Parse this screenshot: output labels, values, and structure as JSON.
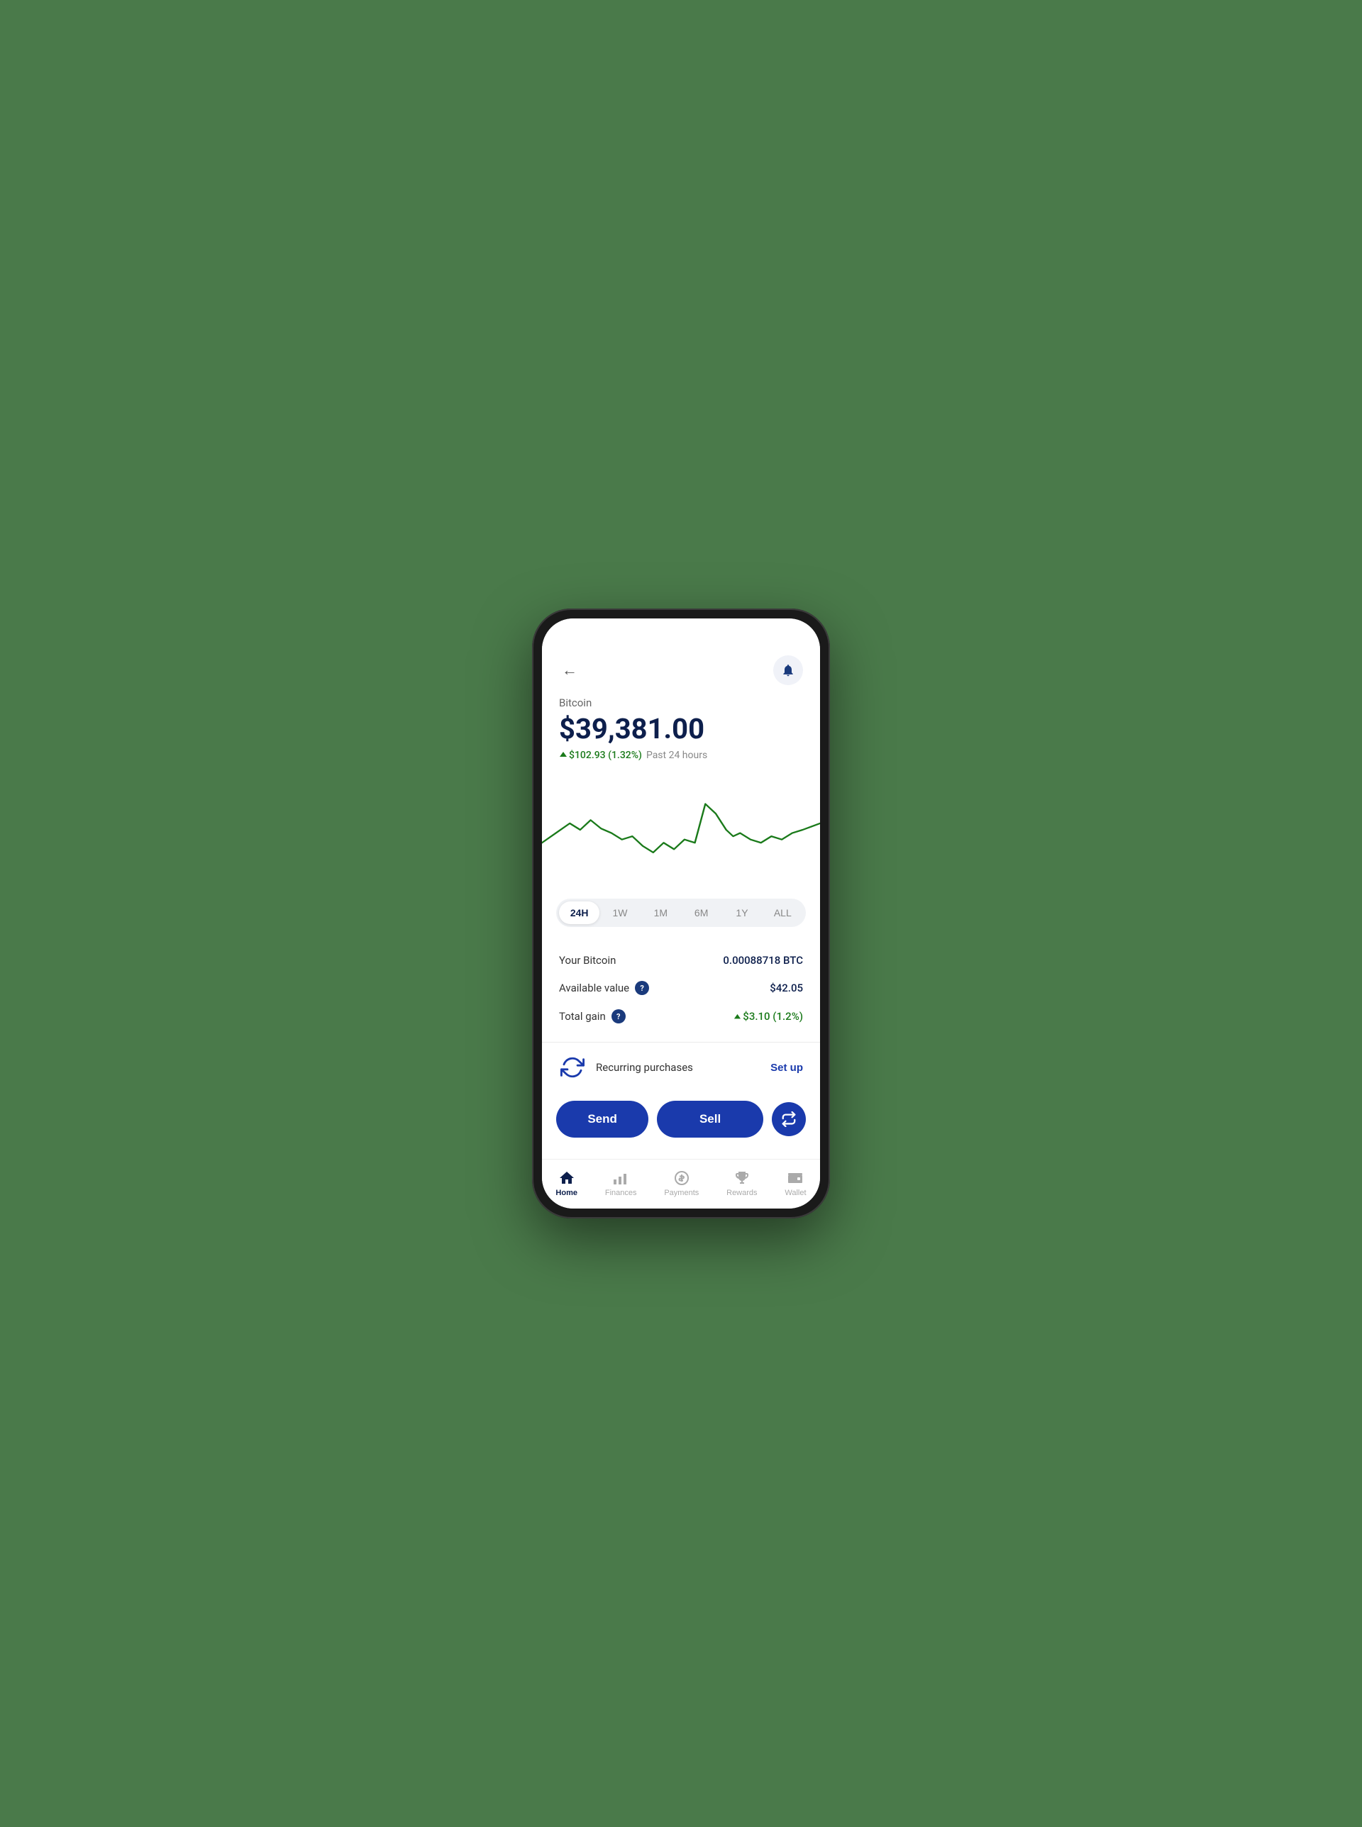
{
  "header": {
    "back_label": "←",
    "notification_icon": "bell"
  },
  "coin": {
    "name": "Bitcoin",
    "price": "$39,381.00",
    "change_amount": "$102.93",
    "change_percent": "(1.32%)",
    "change_period": "Past 24 hours"
  },
  "time_filters": [
    {
      "label": "24H",
      "active": true
    },
    {
      "label": "1W",
      "active": false
    },
    {
      "label": "1M",
      "active": false
    },
    {
      "label": "6M",
      "active": false
    },
    {
      "label": "1Y",
      "active": false
    },
    {
      "label": "ALL",
      "active": false
    }
  ],
  "stats": {
    "your_bitcoin_label": "Your Bitcoin",
    "your_bitcoin_value": "0.00088718 BTC",
    "available_value_label": "Available value",
    "available_value_value": "$42.05",
    "total_gain_label": "Total gain",
    "total_gain_value": "↑ $3.10 (1.2%)"
  },
  "recurring": {
    "label": "Recurring purchases",
    "action": "Set up"
  },
  "actions": {
    "send_label": "Send",
    "sell_label": "Sell",
    "swap_icon": "⇄"
  },
  "nav": [
    {
      "label": "Home",
      "icon": "home",
      "active": true
    },
    {
      "label": "Finances",
      "icon": "finances",
      "active": false
    },
    {
      "label": "Payments",
      "icon": "payments",
      "active": false
    },
    {
      "label": "Rewards",
      "icon": "rewards",
      "active": false
    },
    {
      "label": "Wallet",
      "icon": "wallet",
      "active": false
    }
  ]
}
